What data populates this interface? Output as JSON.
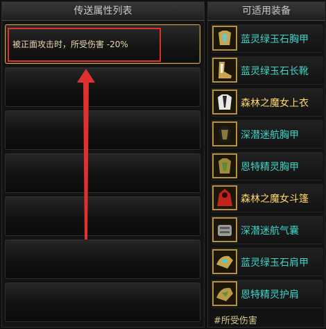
{
  "left_panel": {
    "title": "传送属性列表",
    "slots": [
      {
        "text": "被正面攻击时，所受伤害 -20%"
      },
      {
        "text": ""
      },
      {
        "text": ""
      },
      {
        "text": ""
      },
      {
        "text": ""
      },
      {
        "text": ""
      },
      {
        "text": ""
      }
    ]
  },
  "right_panel": {
    "title": "可适用装备",
    "items": [
      {
        "name": "蓝灵绿玉石胸甲",
        "icon": "blue-jade-chest-armor-icon",
        "color": "#3fd4c8"
      },
      {
        "name": "蓝灵绿玉石长靴",
        "icon": "blue-jade-boots-icon",
        "color": "#3fd4c8"
      },
      {
        "name": "森林之魔女上衣",
        "icon": "forest-witch-top-icon",
        "color": "#ffd86b"
      },
      {
        "name": "深潜迷航胸甲",
        "icon": "deep-dive-chest-armor-icon",
        "color": "#3fd4c8"
      },
      {
        "name": "恩特精灵胸甲",
        "icon": "ent-spirit-chest-armor-icon",
        "color": "#3fd4c8"
      },
      {
        "name": "森林之魔女斗篷",
        "icon": "forest-witch-cloak-icon",
        "color": "#ffd86b"
      },
      {
        "name": "深潜迷航气囊",
        "icon": "deep-dive-airbag-icon",
        "color": "#3fd4c8"
      },
      {
        "name": "蓝灵绿玉石肩甲",
        "icon": "blue-jade-shoulder-icon",
        "color": "#3fd4c8"
      },
      {
        "name": "恩特精灵护肩",
        "icon": "ent-spirit-shoulder-icon",
        "color": "#3fd4c8"
      }
    ],
    "footer": "#所受伤害"
  },
  "annotation": {
    "box_color": "#e03030",
    "arrow_color": "#e03030"
  }
}
